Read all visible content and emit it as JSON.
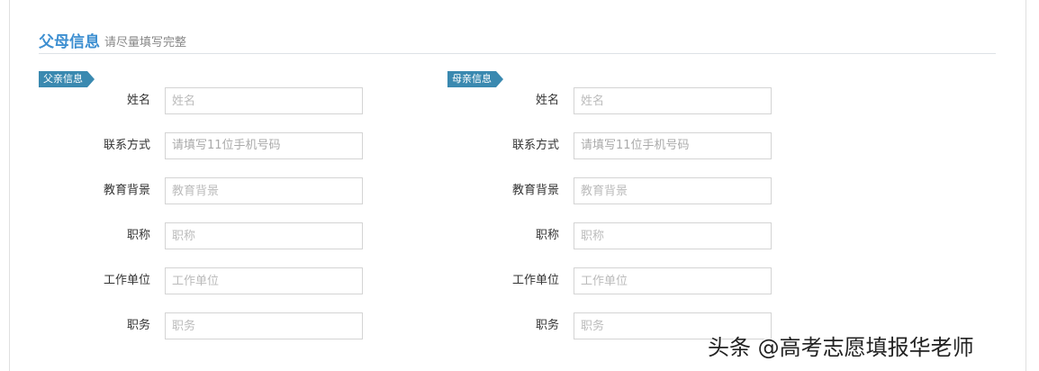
{
  "section": {
    "title": "父母信息",
    "subtitle": "请尽量填写完整"
  },
  "father": {
    "tag": "父亲信息",
    "fields": [
      {
        "label": "姓名",
        "placeholder": "姓名"
      },
      {
        "label": "联系方式",
        "placeholder": "请填写11位手机号码"
      },
      {
        "label": "教育背景",
        "placeholder": "教育背景"
      },
      {
        "label": "职称",
        "placeholder": "职称"
      },
      {
        "label": "工作单位",
        "placeholder": "工作单位"
      },
      {
        "label": "职务",
        "placeholder": "职务"
      }
    ]
  },
  "mother": {
    "tag": "母亲信息",
    "fields": [
      {
        "label": "姓名",
        "placeholder": "姓名"
      },
      {
        "label": "联系方式",
        "placeholder": "请填写11位手机号码"
      },
      {
        "label": "教育背景",
        "placeholder": "教育背景"
      },
      {
        "label": "职称",
        "placeholder": "职称"
      },
      {
        "label": "工作单位",
        "placeholder": "工作单位"
      },
      {
        "label": "职务",
        "placeholder": "职务"
      }
    ]
  },
  "watermark": "头条 @高考志愿填报华老师"
}
